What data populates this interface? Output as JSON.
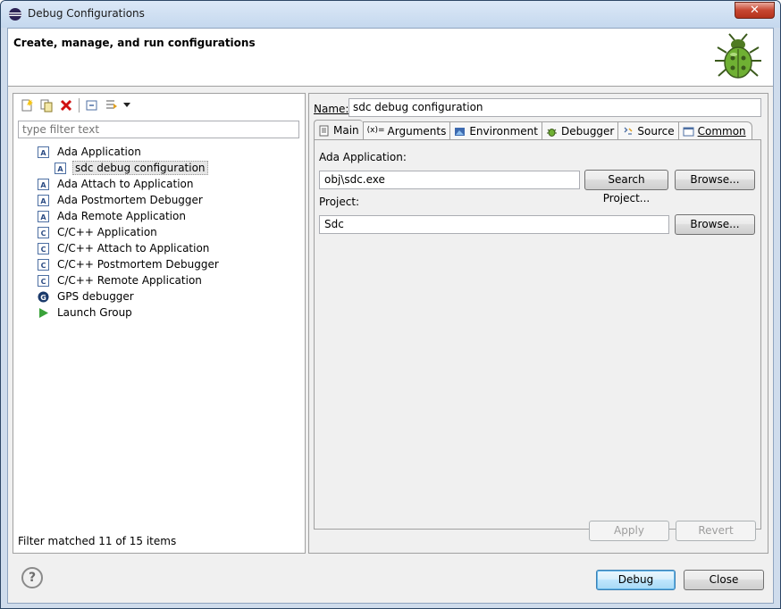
{
  "window": {
    "title": "Debug Configurations",
    "close_label": "✕"
  },
  "banner": {
    "title": "Create, manage, and run configurations"
  },
  "left": {
    "filter_placeholder": "type filter text",
    "tree": [
      {
        "label": "Ada Application",
        "icon": "ada-icon",
        "level": 0
      },
      {
        "label": "sdc debug configuration",
        "icon": "ada-icon",
        "level": 1,
        "selected": true
      },
      {
        "label": "Ada Attach to Application",
        "icon": "ada-icon",
        "level": 0
      },
      {
        "label": "Ada Postmortem Debugger",
        "icon": "ada-icon",
        "level": 0
      },
      {
        "label": "Ada Remote Application",
        "icon": "ada-icon",
        "level": 0
      },
      {
        "label": "C/C++ Application",
        "icon": "c-icon",
        "level": 0
      },
      {
        "label": "C/C++ Attach to Application",
        "icon": "c-icon",
        "level": 0
      },
      {
        "label": "C/C++ Postmortem Debugger",
        "icon": "c-icon",
        "level": 0
      },
      {
        "label": "C/C++ Remote Application",
        "icon": "c-icon",
        "level": 0
      },
      {
        "label": "GPS debugger",
        "icon": "gps-icon",
        "level": 0
      },
      {
        "label": "Launch Group",
        "icon": "launch-icon",
        "level": 0
      }
    ],
    "status": "Filter matched 11 of 15 items"
  },
  "right": {
    "name_label": "Name:",
    "name_value": "sdc debug configuration",
    "tabs": [
      "Main",
      "Arguments",
      "Environment",
      "Debugger",
      "Source",
      "Common"
    ],
    "ada_app_label": "Ada Application:",
    "ada_app_value": "obj\\sdc.exe",
    "search_project": "Search Project...",
    "browse1": "Browse...",
    "project_label": "Project:",
    "project_value": "Sdc",
    "browse2": "Browse...",
    "apply": "Apply",
    "revert": "Revert"
  },
  "footer": {
    "help": "?",
    "debug": "Debug",
    "close": "Close"
  }
}
